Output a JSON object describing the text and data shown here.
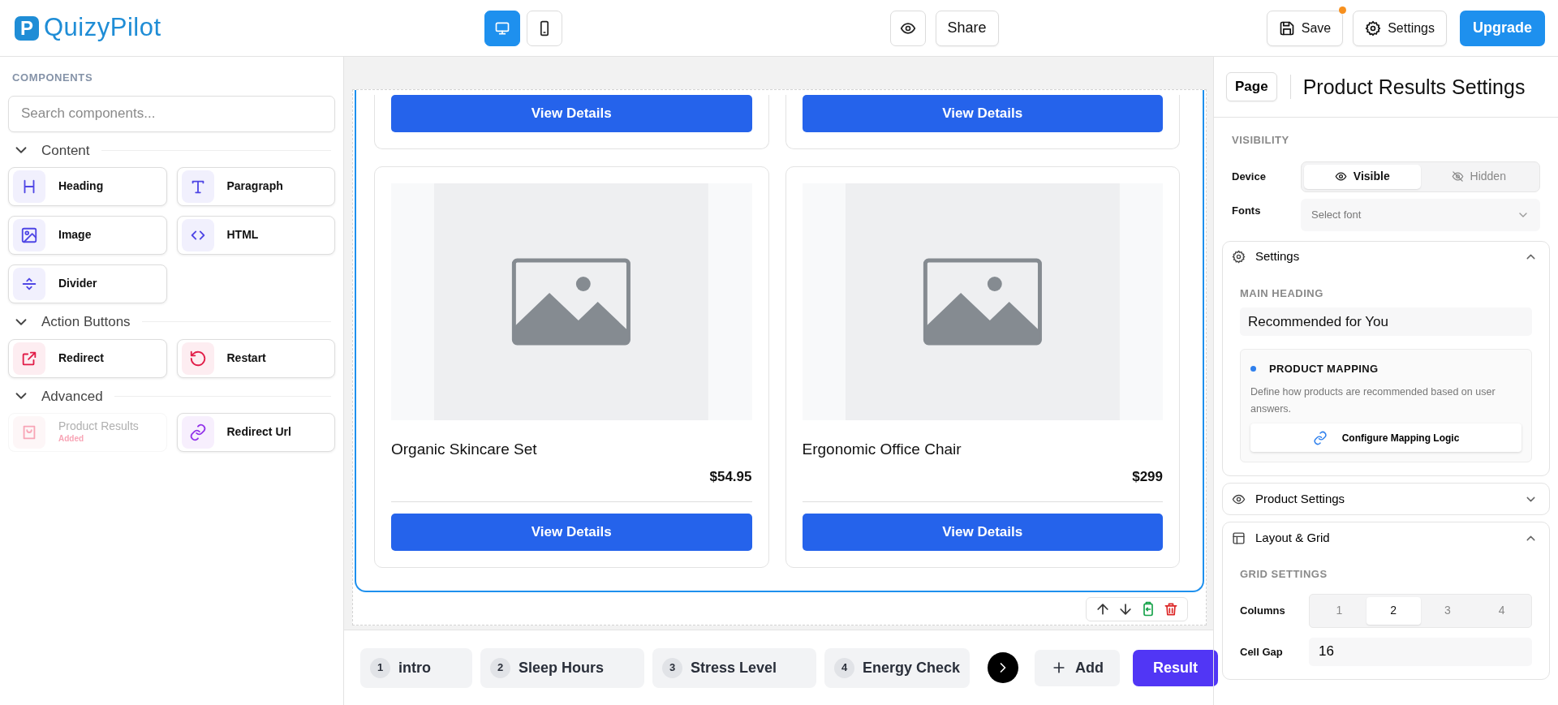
{
  "app": {
    "logo_mark": "P",
    "logo_text": "QuizyPilot"
  },
  "toolbar": {
    "devices": [
      {
        "kind": "desktop",
        "selected": true
      },
      {
        "kind": "mobile",
        "selected": false
      }
    ],
    "share": "Share",
    "save": {
      "label": "Save",
      "unsaved": true
    },
    "settings": "Settings",
    "upgrade": "Upgrade"
  },
  "sidebar": {
    "title": "COMPONENTS",
    "search_placeholder": "Search components...",
    "groups": [
      {
        "label": "Content",
        "expanded": true,
        "items": [
          {
            "label": "Heading",
            "kind": "heading",
            "color": "#4f46e5",
            "disabled": false
          },
          {
            "label": "Paragraph",
            "kind": "paragraph",
            "color": "#4f46e5",
            "disabled": false
          },
          {
            "label": "Image",
            "kind": "image",
            "color": "#4f46e5",
            "disabled": false
          },
          {
            "label": "HTML",
            "kind": "html",
            "color": "#4f46e5",
            "disabled": false
          },
          {
            "label": "Divider",
            "kind": "divider",
            "color": "#4f46e5",
            "disabled": false
          }
        ]
      },
      {
        "label": "Action Buttons",
        "expanded": true,
        "items": [
          {
            "label": "Redirect",
            "kind": "redirect",
            "color": "#e11d48",
            "disabled": false
          },
          {
            "label": "Restart",
            "kind": "restart",
            "color": "#e11d48",
            "disabled": false
          }
        ]
      },
      {
        "label": "Advanced",
        "expanded": true,
        "items": [
          {
            "label": "Product Results",
            "kind": "product",
            "color": "#f8a5b6",
            "disabled": true,
            "badge": "Added"
          },
          {
            "label": "Redirect Url",
            "kind": "link",
            "color": "#9333ea",
            "disabled": false
          }
        ]
      }
    ]
  },
  "canvas": {
    "cards": [
      {
        "kind": "cut",
        "button": "View Details"
      },
      {
        "kind": "cut",
        "button": "View Details"
      },
      {
        "kind": "full",
        "name": "Organic Skincare Set",
        "price": "$54.95",
        "button": "View Details"
      },
      {
        "kind": "full",
        "name": "Ergonomic Office Chair",
        "price": "$299",
        "button": "View Details"
      }
    ]
  },
  "steps": {
    "items": [
      {
        "number": "1",
        "label": "intro"
      },
      {
        "number": "2",
        "label": "Sleep Hours"
      },
      {
        "number": "3",
        "label": "Stress Level"
      },
      {
        "number": "4",
        "label": "Energy Check"
      }
    ],
    "add": "Add",
    "result": "Result"
  },
  "panel": {
    "page_button": "Page",
    "title": "Product Results Settings",
    "visibility": {
      "heading": "VISIBILITY",
      "device_label": "Device",
      "options": [
        {
          "kind": "visible",
          "label": "Visible",
          "selected": true
        },
        {
          "kind": "hidden",
          "label": "Hidden",
          "selected": false
        }
      ],
      "fonts_label": "Fonts",
      "fonts_placeholder": "Select font"
    },
    "sections": [
      {
        "kind": "settings",
        "title": "Settings",
        "expanded": true,
        "heading_label": "MAIN HEADING",
        "heading_value": "Recommended for You",
        "mapping": {
          "title": "PRODUCT MAPPING",
          "description": "Define how products are recommended based on user answers.",
          "button": "Configure Mapping Logic"
        }
      },
      {
        "kind": "product",
        "title": "Product Settings",
        "expanded": false
      },
      {
        "kind": "layout",
        "title": "Layout & Grid",
        "expanded": true,
        "grid_label": "GRID SETTINGS",
        "columns_label": "Columns",
        "columns": [
          {
            "label": "1",
            "selected": false
          },
          {
            "label": "2",
            "selected": true
          },
          {
            "label": "3",
            "selected": false
          },
          {
            "label": "4",
            "selected": false
          }
        ],
        "gap_label": "Cell Gap",
        "gap_value": "16"
      }
    ]
  }
}
